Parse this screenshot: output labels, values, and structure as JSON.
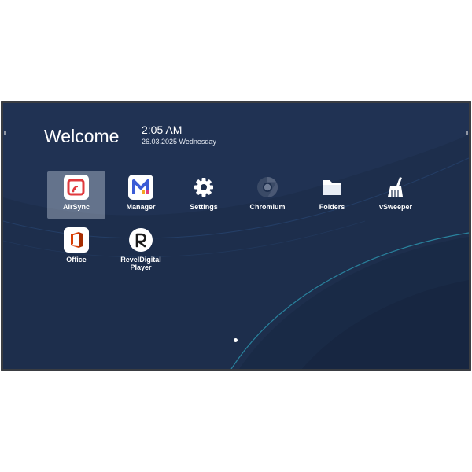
{
  "header": {
    "welcome": "Welcome",
    "time": "2:05 AM",
    "date": "26.03.2025 Wednesday"
  },
  "apps": [
    {
      "label": "AirSync",
      "icon": "airsync-icon",
      "selected": true
    },
    {
      "label": "Manager",
      "icon": "manager-icon"
    },
    {
      "label": "Settings",
      "icon": "gear-icon"
    },
    {
      "label": "Chromium",
      "icon": "chromium-icon"
    },
    {
      "label": "Folders",
      "icon": "folder-icon"
    },
    {
      "label": "vSweeper",
      "icon": "broom-icon"
    },
    {
      "label": "Office",
      "icon": "office-icon"
    },
    {
      "label": "RevelDigital\nPlayer",
      "icon": "reveldigital-icon"
    }
  ],
  "pager": {
    "pages": 1,
    "current": 1
  },
  "colors": {
    "screen_bg": "#1d2e4c",
    "wave_accent": "#2fa6c0",
    "selection": "#c4cddc",
    "airsync_red": "#e03a3e",
    "manager_blue": "#3b5bd6",
    "office_red": "#d83b01"
  }
}
